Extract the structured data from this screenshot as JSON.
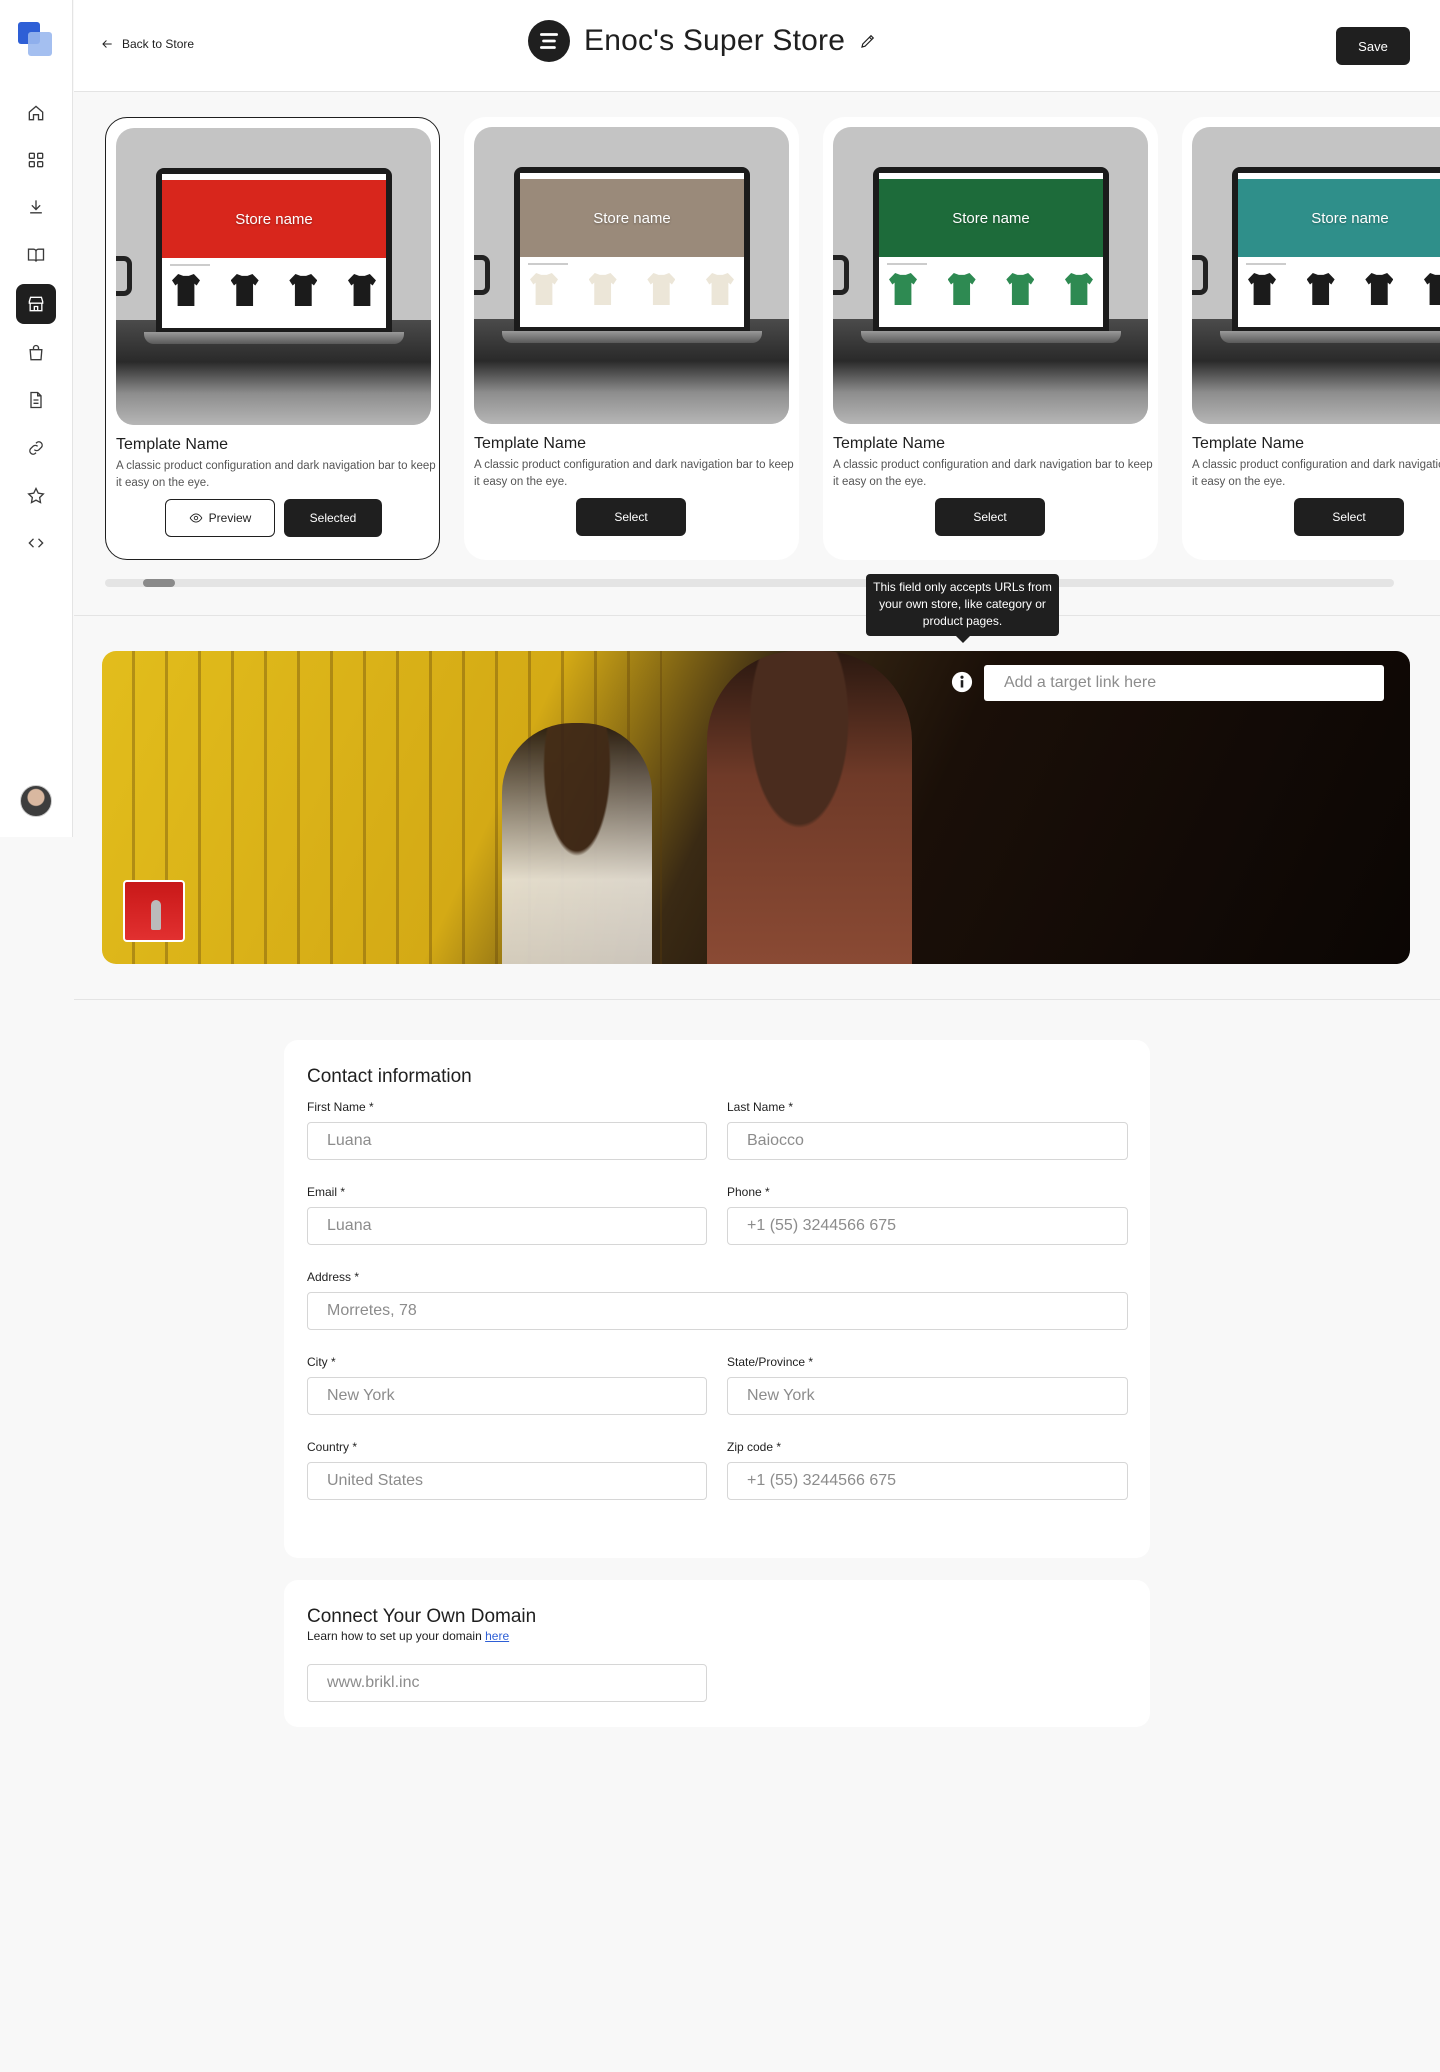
{
  "header": {
    "back_label": "Back to Store",
    "store_name": "Enoc's Super Store",
    "save_label": "Save"
  },
  "sidebar": {
    "items": [
      {
        "icon": "home-icon",
        "active": false
      },
      {
        "icon": "grid-icon",
        "active": false
      },
      {
        "icon": "download-icon",
        "active": false
      },
      {
        "icon": "book-icon",
        "active": false
      },
      {
        "icon": "storefront-icon",
        "active": true
      },
      {
        "icon": "shopping-bag-icon",
        "active": false
      },
      {
        "icon": "document-icon",
        "active": false
      },
      {
        "icon": "link-icon",
        "active": false
      },
      {
        "icon": "star-icon",
        "active": false
      },
      {
        "icon": "code-icon",
        "active": false
      }
    ]
  },
  "templates": [
    {
      "name": "Template Name",
      "description": "A classic product configuration and dark navigation bar to keep it easy on the eye.",
      "store_label": "Store name",
      "hero_color": "#d8261c",
      "product_color": "#1b1b1b",
      "selected": true,
      "preview_label": "Preview",
      "action_label": "Selected"
    },
    {
      "name": "Template Name",
      "description": "A classic product configuration and dark navigation bar to keep it easy on the eye.",
      "store_label": "Store name",
      "hero_color": "#9a8a7a",
      "product_color": "#ece6d8",
      "selected": false,
      "action_label": "Select"
    },
    {
      "name": "Template Name",
      "description": "A classic product configuration and dark navigation bar to keep it easy on the eye.",
      "store_label": "Store name",
      "hero_color": "#1d6b3a",
      "product_color": "#2e8a52",
      "selected": false,
      "action_label": "Select"
    },
    {
      "name": "Template Name",
      "description": "A classic product configuration and dark navigation bar to keep it easy on the eye.",
      "store_label": "Store name",
      "hero_color": "#2f8f8a",
      "product_color": "#1b1b1b",
      "selected": false,
      "action_label": "Select"
    }
  ],
  "carousel": {
    "scroll_progress": 0.03
  },
  "banner": {
    "link_placeholder": "Add a target link here",
    "tooltip": "This field only accepts URLs from your own store, like category or product pages."
  },
  "contact": {
    "title": "Contact information",
    "fields": {
      "first_name": {
        "label": "First Name *",
        "placeholder": "Luana"
      },
      "last_name": {
        "label": "Last Name *",
        "placeholder": "Baiocco"
      },
      "email": {
        "label": "Email *",
        "placeholder": "Luana"
      },
      "phone": {
        "label": "Phone *",
        "placeholder": "+1 (55) 3244566 675"
      },
      "address": {
        "label": "Address *",
        "placeholder": "Morretes, 78"
      },
      "city": {
        "label": "City *",
        "placeholder": "New York"
      },
      "state": {
        "label": "State/Province *",
        "placeholder": "New York"
      },
      "country": {
        "label": "Country *",
        "placeholder": "United States"
      },
      "zip": {
        "label": "Zip code *",
        "placeholder": "+1 (55) 3244566 675"
      }
    }
  },
  "domain": {
    "title": "Connect Your Own Domain",
    "help_text": "Learn how to set up your domain",
    "help_link": "here",
    "placeholder": "www.brikl.inc"
  }
}
